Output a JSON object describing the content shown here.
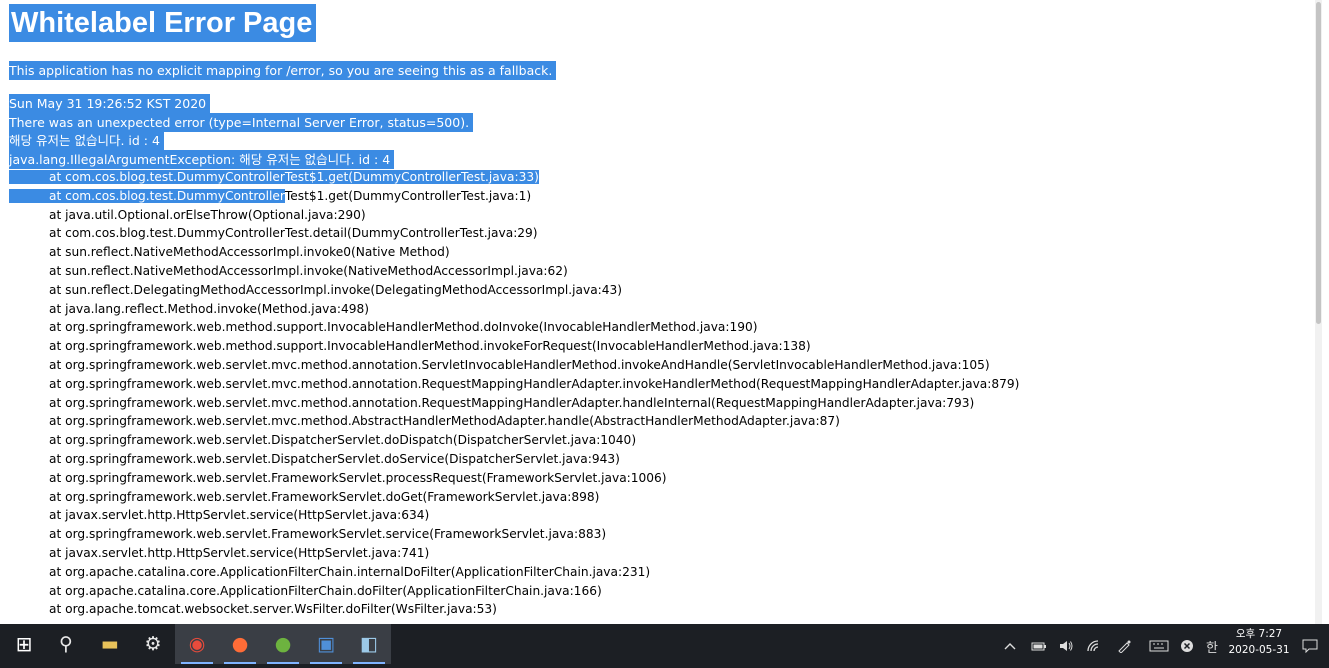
{
  "error_page": {
    "title": "Whitelabel Error Page",
    "fallback_message": "This application has no explicit mapping for /error, so you are seeing this as a fallback.",
    "timestamp": "Sun May 31 19:26:52 KST 2020",
    "error_summary": "There was an unexpected error (type=Internal Server Error, status=500).",
    "message": "해당 유저는 없습니다. id : 4",
    "exception": "java.lang.IllegalArgumentException: 해당 유저는 없습니다. id : 4",
    "stack_frames": [
      "at com.cos.blog.test.DummyControllerTest$1.get(DummyControllerTest.java:33)",
      "at com.cos.blog.test.DummyControllerTest$1.get(DummyControllerTest.java:1)",
      "at java.util.Optional.orElseThrow(Optional.java:290)",
      "at com.cos.blog.test.DummyControllerTest.detail(DummyControllerTest.java:29)",
      "at sun.reflect.NativeMethodAccessorImpl.invoke0(Native Method)",
      "at sun.reflect.NativeMethodAccessorImpl.invoke(NativeMethodAccessorImpl.java:62)",
      "at sun.reflect.DelegatingMethodAccessorImpl.invoke(DelegatingMethodAccessorImpl.java:43)",
      "at java.lang.reflect.Method.invoke(Method.java:498)",
      "at org.springframework.web.method.support.InvocableHandlerMethod.doInvoke(InvocableHandlerMethod.java:190)",
      "at org.springframework.web.method.support.InvocableHandlerMethod.invokeForRequest(InvocableHandlerMethod.java:138)",
      "at org.springframework.web.servlet.mvc.method.annotation.ServletInvocableHandlerMethod.invokeAndHandle(ServletInvocableHandlerMethod.java:105)",
      "at org.springframework.web.servlet.mvc.method.annotation.RequestMappingHandlerAdapter.invokeHandlerMethod(RequestMappingHandlerAdapter.java:879)",
      "at org.springframework.web.servlet.mvc.method.annotation.RequestMappingHandlerAdapter.handleInternal(RequestMappingHandlerAdapter.java:793)",
      "at org.springframework.web.servlet.mvc.method.AbstractHandlerMethodAdapter.handle(AbstractHandlerMethodAdapter.java:87)",
      "at org.springframework.web.servlet.DispatcherServlet.doDispatch(DispatcherServlet.java:1040)",
      "at org.springframework.web.servlet.DispatcherServlet.doService(DispatcherServlet.java:943)",
      "at org.springframework.web.servlet.FrameworkServlet.processRequest(FrameworkServlet.java:1006)",
      "at org.springframework.web.servlet.FrameworkServlet.doGet(FrameworkServlet.java:898)",
      "at javax.servlet.http.HttpServlet.service(HttpServlet.java:634)",
      "at org.springframework.web.servlet.FrameworkServlet.service(FrameworkServlet.java:883)",
      "at javax.servlet.http.HttpServlet.service(HttpServlet.java:741)",
      "at org.apache.catalina.core.ApplicationFilterChain.internalDoFilter(ApplicationFilterChain.java:231)",
      "at org.apache.catalina.core.ApplicationFilterChain.doFilter(ApplicationFilterChain.java:166)",
      "at org.apache.tomcat.websocket.server.WsFilter.doFilter(WsFilter.java:53)"
    ],
    "selection": {
      "full_frames": 1,
      "partial_frame_selected_text": "at com.cos.blog.test.DummyController",
      "partial_frame_rest_text": "Test$1.get(DummyControllerTest.java:1)"
    }
  },
  "taskbar": {
    "apps": [
      {
        "name": "start",
        "icon": "windows-icon",
        "glyph": "⊞"
      },
      {
        "name": "search",
        "icon": "search-icon",
        "glyph": "⚲"
      },
      {
        "name": "file-explorer",
        "icon": "folder-icon",
        "glyph": "▬"
      },
      {
        "name": "settings",
        "icon": "gear-icon",
        "glyph": "⚙"
      },
      {
        "name": "chrome",
        "icon": "chrome-icon",
        "glyph": "◉"
      },
      {
        "name": "postman",
        "icon": "postman-icon",
        "glyph": "●"
      },
      {
        "name": "spring-tool-suite",
        "icon": "leaf-icon",
        "glyph": "●"
      },
      {
        "name": "editor",
        "icon": "editor-icon",
        "glyph": "▣"
      },
      {
        "name": "notes",
        "icon": "notes-icon",
        "glyph": "◧"
      }
    ],
    "tray": {
      "ime_label": "한",
      "time": "오후 7:27",
      "date": "2020-05-31"
    }
  },
  "colors": {
    "selection": "#3b8be3",
    "taskbar": "#1c1f24"
  }
}
